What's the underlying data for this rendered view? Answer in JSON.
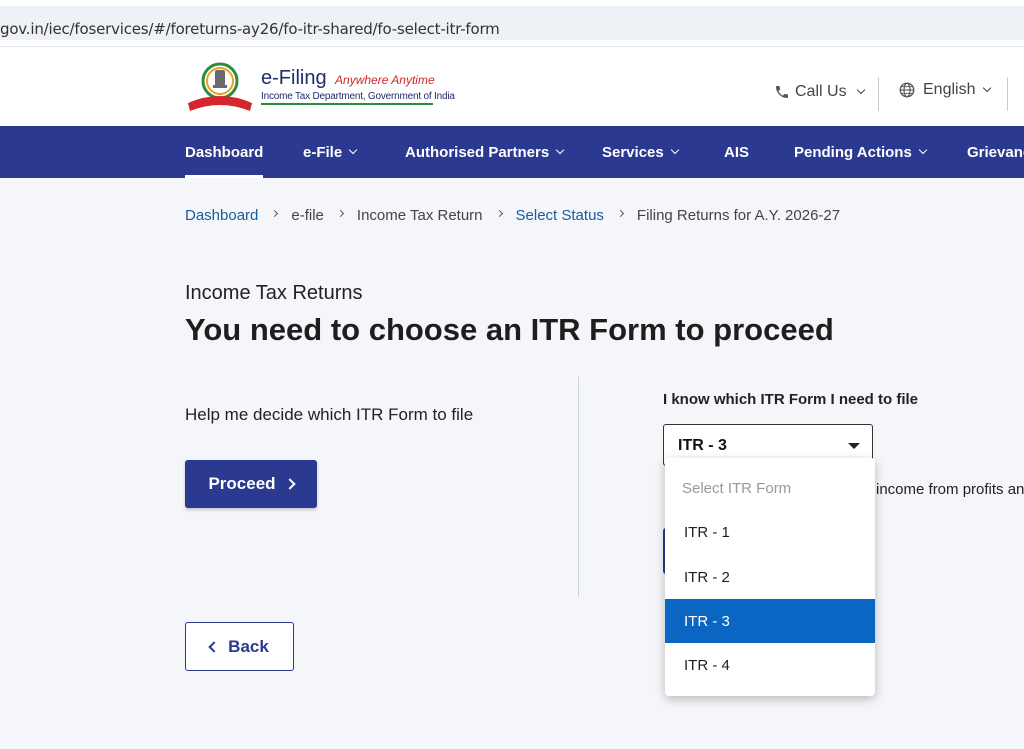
{
  "browser": {
    "url": "gov.in/iec/foservices/#/foreturns-ay26/fo-itr-shared/fo-select-itr-form"
  },
  "header": {
    "brand_name": "e-Filing",
    "brand_tagline": "Anywhere Anytime",
    "brand_sub": "Income Tax Department, Government of India",
    "call_us": "Call Us",
    "language": "English"
  },
  "nav": {
    "items": [
      {
        "label": "Dashboard",
        "active": true
      },
      {
        "label": "e-File",
        "dropdown": true
      },
      {
        "label": "Authorised Partners",
        "dropdown": true
      },
      {
        "label": "Services",
        "dropdown": true
      },
      {
        "label": "AIS"
      },
      {
        "label": "Pending Actions",
        "dropdown": true
      },
      {
        "label": "Grievanc"
      }
    ]
  },
  "breadcrumb": [
    {
      "label": "Dashboard",
      "link": true
    },
    {
      "label": "e-file"
    },
    {
      "label": "Income Tax Return"
    },
    {
      "label": "Select Status",
      "link": true
    },
    {
      "label": "Filing Returns for A.Y. 2026-27"
    }
  ],
  "main": {
    "subtitle": "Income Tax Returns",
    "title": "You need to choose an ITR Form to proceed",
    "help_text": "Help me decide which ITR Form to file",
    "proceed_label": "Proceed",
    "know_label": "I know which ITR Form I need to file",
    "selected_form": "ITR - 3",
    "partial_text": "income from profits an",
    "back_label": "Back"
  },
  "dropdown": {
    "placeholder": "Select ITR Form",
    "options": [
      "ITR - 1",
      "ITR - 2",
      "ITR - 3",
      "ITR - 4"
    ],
    "selected": "ITR - 3"
  },
  "colors": {
    "primary": "#2b3990",
    "selected_option": "#0b66c3",
    "link": "#1a5a9e"
  }
}
